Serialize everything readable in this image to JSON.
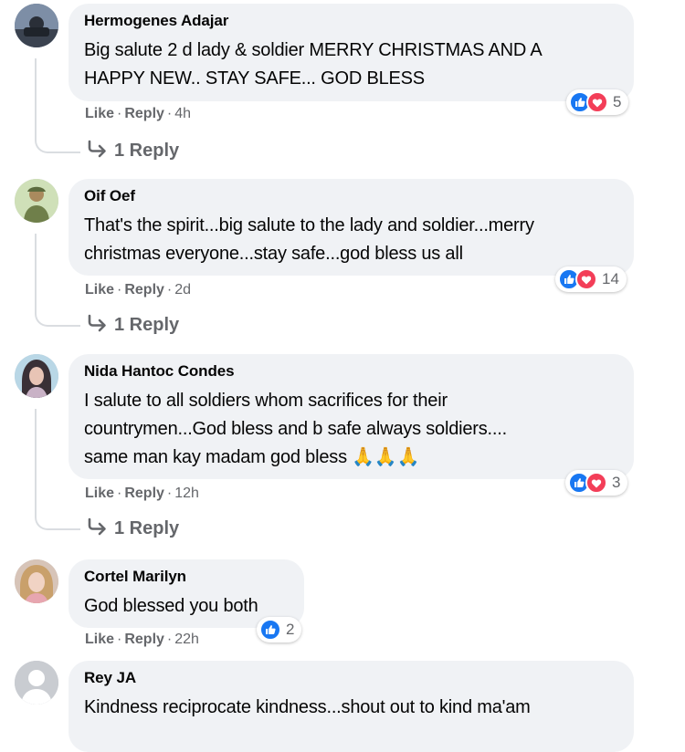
{
  "comments": [
    {
      "author": "Hermogenes Adajar",
      "lines": [
        "Big salute 2 d lady & soldier MERRY CHRISTMAS AND A",
        "HAPPY NEW.. STAY SAFE... GOD BLESS"
      ],
      "like": "Like",
      "reply": "Reply",
      "time": "4h",
      "reactions": [
        "like",
        "love"
      ],
      "reaction_count": "5",
      "replies_label": "1 Reply"
    },
    {
      "author": "Oif Oef",
      "lines": [
        "That's the spirit...big salute to the lady and soldier...merry",
        "christmas everyone...stay safe...god bless us all"
      ],
      "like": "Like",
      "reply": "Reply",
      "time": "2d",
      "reactions": [
        "like",
        "love"
      ],
      "reaction_count": "14",
      "replies_label": "1 Reply"
    },
    {
      "author": "Nida Hantoc Condes",
      "lines": [
        "I salute to all soldiers whom sacrifices for their",
        "countrymen...God bless and b safe always soldiers....",
        "same man kay madam god bless 🙏🙏🙏"
      ],
      "like": "Like",
      "reply": "Reply",
      "time": "12h",
      "reactions": [
        "like",
        "love"
      ],
      "reaction_count": "3",
      "replies_label": "1 Reply"
    },
    {
      "author": "Cortel Marilyn",
      "lines": [
        "God blessed you both"
      ],
      "like": "Like",
      "reply": "Reply",
      "time": "22h",
      "reactions": [
        "like"
      ],
      "reaction_count": "2"
    },
    {
      "author": "Rey JA",
      "lines": [
        "Kindness reciprocate kindness...shout out to kind ma'am"
      ]
    }
  ],
  "colors": {
    "like": "#1877f2",
    "love": "#f33e58",
    "secondary_text": "#65676b",
    "bubble": "#f0f2f5"
  }
}
